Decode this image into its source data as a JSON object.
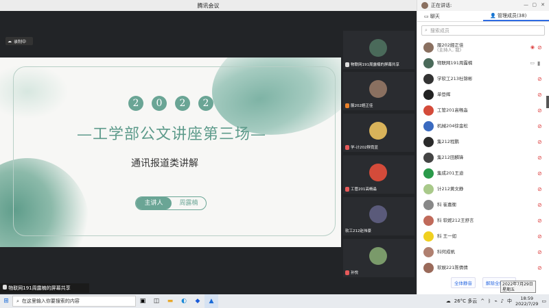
{
  "window": {
    "title": "腾讯会议"
  },
  "recording": {
    "label": "录制中"
  },
  "slide": {
    "year_digits": [
      "2",
      "0",
      "2",
      "2"
    ],
    "headline": "—工学部公文讲座第三场—",
    "subtitle": "通讯报道类讲解",
    "speaker_label": "主讲人",
    "speaker_name": "周露楠"
  },
  "share_bar": {
    "label": "物联网191周露楠的屏幕共享"
  },
  "thumbnails": [
    {
      "name": "物联网191周露楠的屏幕共享",
      "color": "#4a6a5a"
    },
    {
      "name": "服202經正佳",
      "color": "#8a7060"
    },
    {
      "name": "学-计202穆竟显",
      "color": "#d9b35a"
    },
    {
      "name": "工管201高畅淼",
      "color": "#d44b3a"
    },
    {
      "name": "软工212赵伟豪",
      "color": "#5a5a7a"
    },
    {
      "name": "孙悦",
      "color": "#7a9a6a"
    }
  ],
  "sidebar": {
    "speaking_label": "正在讲话:",
    "tab_chat": "聊天",
    "tab_members": "管理成员(38)",
    "search_placeholder": "搜索成员",
    "members": [
      {
        "name": "服202經正佳",
        "sub": "(主持人, 我)",
        "color": "#8a7060"
      },
      {
        "name": "物联网191周露楠",
        "sub": "",
        "color": "#4a6a5a"
      },
      {
        "name": "学软工213杜锦彬",
        "sub": "",
        "color": "#333"
      },
      {
        "name": "单登辉",
        "sub": "",
        "color": "#222"
      },
      {
        "name": "工管201高畅淼",
        "sub": "",
        "color": "#d44b3a"
      },
      {
        "name": "机械204徐金松",
        "sub": "",
        "color": "#3a6ac0"
      },
      {
        "name": "集212程鹏",
        "sub": "",
        "color": "#2a2a2a"
      },
      {
        "name": "集212田麟锋",
        "sub": "",
        "color": "#444"
      },
      {
        "name": "集成201王迪",
        "sub": "",
        "color": "#2a9a4a"
      },
      {
        "name": "计212黄文静",
        "sub": "",
        "color": "#a9c98a"
      },
      {
        "name": "科 崔嘉衡",
        "sub": "",
        "color": "#888"
      },
      {
        "name": "科 软妮212王舒言",
        "sub": "",
        "color": "#c06a5a"
      },
      {
        "name": "科 王一如",
        "sub": "",
        "color": "#f0d020"
      },
      {
        "name": "科何成帆",
        "sub": "",
        "color": "#b08070"
      },
      {
        "name": "软娱221陈倩倩",
        "sub": "",
        "color": "#9a6a5a"
      }
    ],
    "btn_mute_all": "全体静音",
    "btn_unmute_all": "解除全体静音"
  },
  "tooltip": {
    "line1": "2022年7月29日",
    "line2": "星期五"
  },
  "taskbar": {
    "search_placeholder": "在这里输入你要搜索的内容",
    "weather": "26°C 多云",
    "ime": "中",
    "time": "18:59",
    "date": "2022/7/29"
  }
}
